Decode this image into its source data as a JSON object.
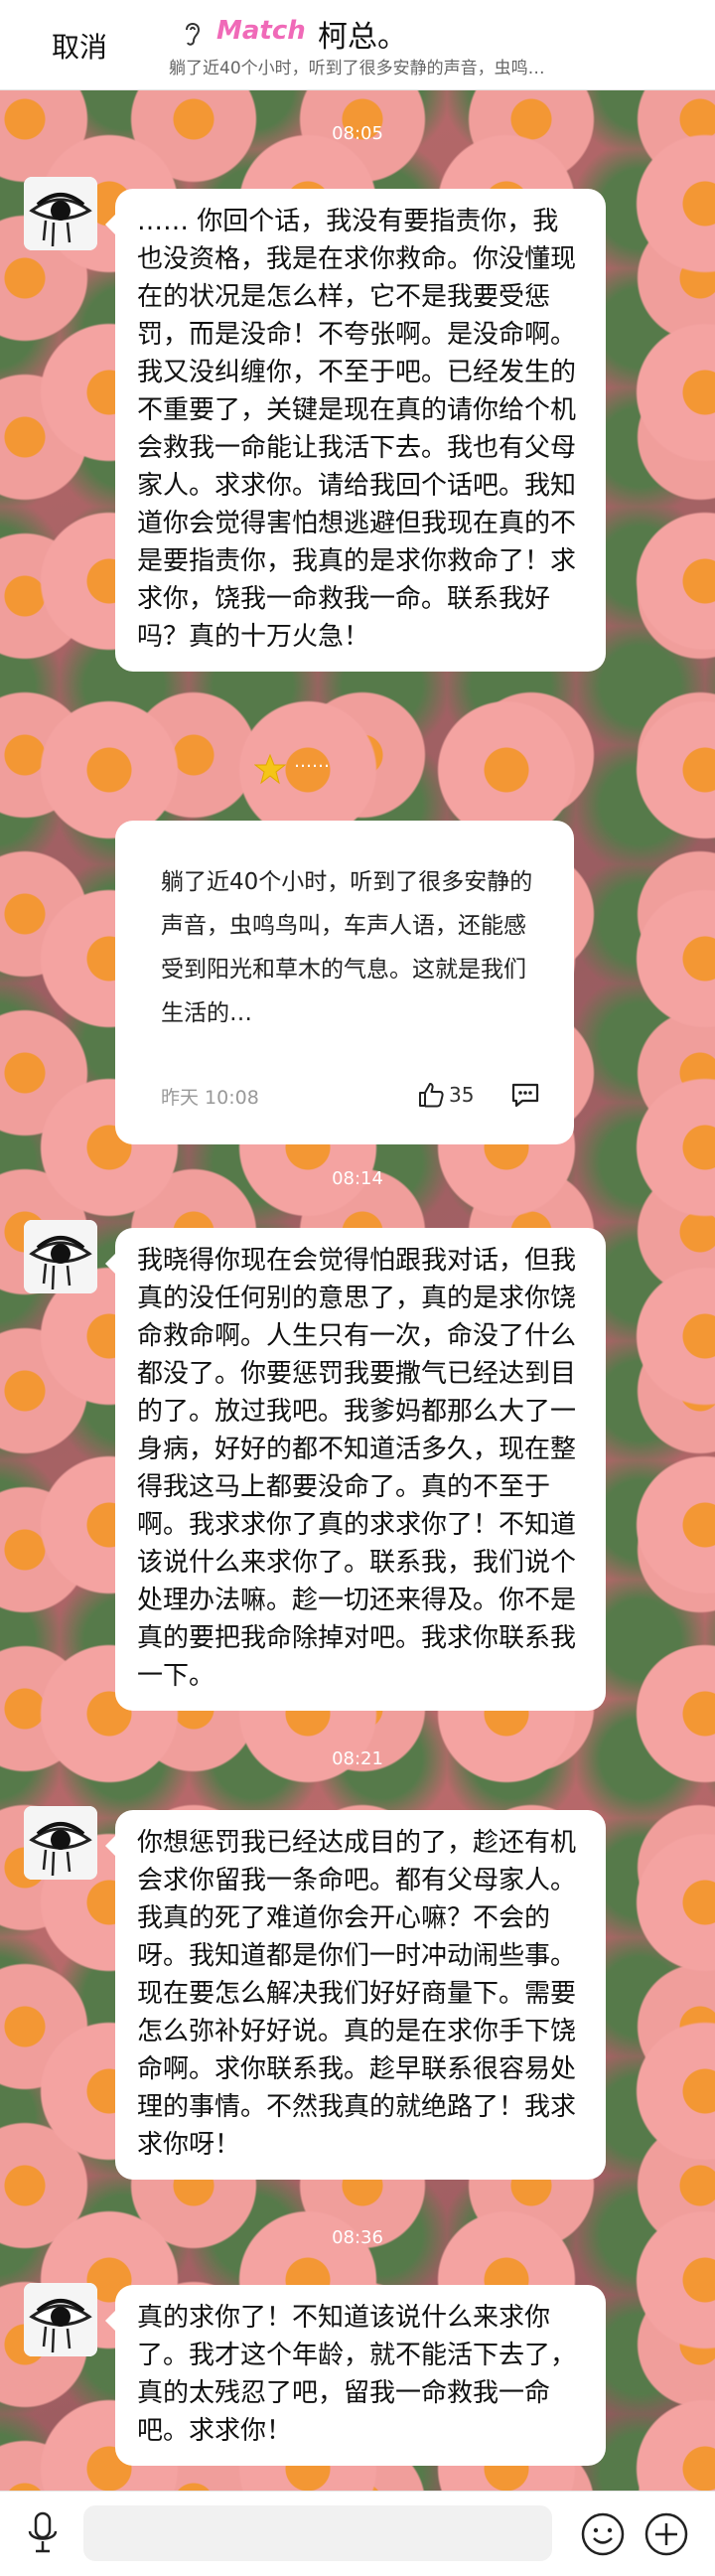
{
  "header": {
    "cancel_label": "取消",
    "logo_text": "Match",
    "title": "柯总。",
    "subtitle": "躺了近40个小时，听到了很多安静的声音，虫鸣…"
  },
  "messages": [
    {
      "time": "08:05",
      "text": "…… 你回个话，我没有要指责你，我也没资格，我是在求你救命。你没懂现在的状况是怎么样，它不是我要受惩罚，而是没命！不夸张啊。是没命啊。我又没纠缠你，不至于吧。已经发生的不重要了，关键是现在真的请你给个机会救我一命能让我活下去。我也有父母家人。求求你。请给我回个话吧。我知道你会觉得害怕想逃避但我现在真的不是要指责你，我真的是求你救命了！求求你，饶我一命救我一命。联系我好吗？真的十万火急！"
    },
    {
      "time": "08:14",
      "text": "我晓得你现在会觉得怕跟我对话，但我真的没任何别的意思了，真的是求你饶命救命啊。人生只有一次，命没了什么都没了。你要惩罚我要撒气已经达到目的了。放过我吧。我爹妈都那么大了一身病，好好的都不知道活多久，现在整得我这马上都要没命了。真的不至于啊。我求求你了真的求求你了！不知道该说什么来求你了。联系我，我们说个处理办法嘛。趁一切还来得及。你不是真的要把我命除掉对吧。我求你联系我一下。"
    },
    {
      "time": "08:21",
      "text": "你想惩罚我已经达成目的了，趁还有机会求你留我一条命吧。都有父母家人。我真的死了难道你会开心嘛？不会的呀。我知道都是你们一时冲动闹些事。现在要怎么解决我们好好商量下。需要怎么弥补好好说。真的是在求你手下饶命啊。求你联系我。趁早联系很容易处理的事情。不然我真的就绝路了！我求求你呀！"
    },
    {
      "time": "08:36",
      "text": "真的求你了！不知道该说什么来求你了。我才这个年龄，就不能活下去了，真的太残忍了吧，留我一命救我一命吧。求求你！"
    }
  ],
  "shared_post": {
    "label": "……",
    "text": "躺了近40个小时，听到了很多安静的声音，虫鸣鸟叫，车声人语，还能感受到阳光和草木的气息。这就是我们生活的…",
    "time": "昨天 10:08",
    "likes": "35"
  },
  "input": {
    "placeholder": ""
  },
  "colors": {
    "accent_pink": "#f06ab8",
    "bubble": "#ffffff",
    "wallpaper_petal": "#f39a98",
    "wallpaper_center": "#f28c1c"
  },
  "icons": [
    "ear-icon",
    "match-logo",
    "avatar-eye-icon",
    "star-icon",
    "like-icon",
    "comment-icon",
    "voice-icon",
    "emoji-icon",
    "plus-icon"
  ]
}
